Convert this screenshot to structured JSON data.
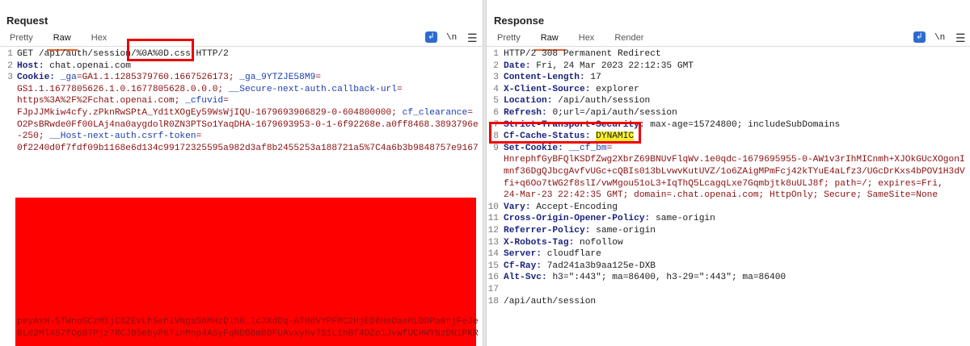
{
  "request": {
    "title": "Request",
    "tabs": [
      "Pretty",
      "Raw",
      "Hex"
    ],
    "active_tab": "Raw",
    "newline_toggle": "\\n",
    "menu_icon": "hamburger-icon",
    "lines": [
      {
        "n": "1",
        "parts": [
          {
            "t": "GET /api/auth/session/%0A%0D.css HTTP/2",
            "c": "val"
          }
        ]
      },
      {
        "n": "2",
        "parts": [
          {
            "t": "Host: ",
            "c": "key"
          },
          {
            "t": "chat.openai.com",
            "c": "val"
          }
        ]
      },
      {
        "n": "3",
        "parts": [
          {
            "t": "Cookie: ",
            "c": "key"
          },
          {
            "t": "_ga",
            "c": "blue"
          },
          {
            "t": "=GA1.1.1285379760.1667526173; ",
            "c": "maroon"
          },
          {
            "t": "_ga_9YTZJE58M9",
            "c": "blue"
          },
          {
            "t": "=",
            "c": "maroon"
          }
        ]
      },
      {
        "n": "",
        "parts": [
          {
            "t": "GS1.1.1677805626.1.0.1677805628.0.0.0; ",
            "c": "maroon"
          },
          {
            "t": "__Secure-next-auth.callback-url",
            "c": "blue"
          },
          {
            "t": "=",
            "c": "maroon"
          }
        ]
      },
      {
        "n": "",
        "parts": [
          {
            "t": "https%3A%2F%2Fchat.openai.com; ",
            "c": "maroon"
          },
          {
            "t": "_cfuvid",
            "c": "blue"
          },
          {
            "t": "=",
            "c": "maroon"
          }
        ]
      },
      {
        "n": "",
        "parts": [
          {
            "t": "FJpJJMkiw4cfy.zPknRwSPtA_Yd1tXOgEy59WsWjIQU-1679693906829-0-604800000; ",
            "c": "maroon"
          },
          {
            "t": "cf_clearance",
            "c": "blue"
          },
          {
            "t": "=",
            "c": "maroon"
          }
        ]
      },
      {
        "n": "",
        "parts": [
          {
            "t": "O2PsBRwde0Ff00LAj4na0aygdolR0ZN3PTSo1YaqDHA-1679693953-0-1-6f92268e.a0ff8468.3893796e",
            "c": "maroon"
          }
        ]
      },
      {
        "n": "",
        "parts": [
          {
            "t": "-250; ",
            "c": "maroon"
          },
          {
            "t": "__Host-next-auth.csrf-token",
            "c": "blue"
          },
          {
            "t": "=",
            "c": "maroon"
          }
        ]
      },
      {
        "n": "",
        "parts": [
          {
            "t": "0f2240d0f7fdf09b1168e6d134c99172325595a982d3af8b2455253a188721a5%7C4a6b3b9848757e9167",
            "c": "maroon"
          }
        ]
      }
    ],
    "tail_lines": [
      {
        "n": "",
        "parts": [
          {
            "t": "peyAxH-5TWnoGCzM1jC8ZEvLhSehIVNgaS6MHzDlh0_lc3XdDq-ATH8VYPFMC2HjED6HeOaeHLDDPa0rjFeJe",
            "c": "maroon"
          }
        ]
      },
      {
        "n": "",
        "parts": [
          {
            "t": "8Ld2Ml4S7fOpB7Pjz7RCJB5ebyP6TinMnp4ASyFqNDBBm0DFUAvxyhv7S1L1hBf4DZo1JvWfUCHWYNzDN1PKR",
            "c": "maroon"
          }
        ]
      }
    ]
  },
  "response": {
    "title": "Response",
    "tabs": [
      "Pretty",
      "Raw",
      "Hex",
      "Render"
    ],
    "active_tab": "Raw",
    "newline_toggle": "\\n",
    "menu_icon": "hamburger-icon",
    "lines": [
      {
        "n": "1",
        "parts": [
          {
            "t": "HTTP/2 308 Permanent Redirect",
            "c": "val"
          }
        ]
      },
      {
        "n": "2",
        "parts": [
          {
            "t": "Date: ",
            "c": "key"
          },
          {
            "t": "Fri, 24 Mar 2023 22:12:35 GMT",
            "c": "val"
          }
        ]
      },
      {
        "n": "3",
        "parts": [
          {
            "t": "Content-Length: ",
            "c": "key"
          },
          {
            "t": "17",
            "c": "val"
          }
        ]
      },
      {
        "n": "4",
        "parts": [
          {
            "t": "X-Client-Source: ",
            "c": "key"
          },
          {
            "t": "explorer",
            "c": "val"
          }
        ]
      },
      {
        "n": "5",
        "parts": [
          {
            "t": "Location: ",
            "c": "key"
          },
          {
            "t": "/api/auth/session",
            "c": "val"
          }
        ]
      },
      {
        "n": "6",
        "parts": [
          {
            "t": "Refresh: ",
            "c": "key"
          },
          {
            "t": "0;url=/api/auth/session",
            "c": "val"
          }
        ]
      },
      {
        "n": "7",
        "parts": [
          {
            "t": "Strict-Transport-Security: ",
            "c": "key"
          },
          {
            "t": "max-age=15724800; includeSubDomains",
            "c": "val"
          }
        ]
      },
      {
        "n": "8",
        "parts": [
          {
            "t": "Cf-Cache-Status: ",
            "c": "key"
          },
          {
            "t": "DYNAMIC",
            "c": "val hl"
          }
        ]
      },
      {
        "n": "9",
        "parts": [
          {
            "t": "Set-Cookie: ",
            "c": "key"
          },
          {
            "t": "__cf_bm",
            "c": "blue"
          },
          {
            "t": "=",
            "c": "maroon"
          }
        ]
      },
      {
        "n": "",
        "parts": [
          {
            "t": "HnrephfGyBFQlKSDfZwg2XbrZ69BNUvFlqWv.1e0qdc-1679695955-0-AW1v3rIhMICnmh+XJOkGUcXOgonI",
            "c": "maroon"
          }
        ]
      },
      {
        "n": "",
        "parts": [
          {
            "t": "mnf36DgQJbcgAvfvUGc+cQBIs013bLvwvKutUVZ/1o6ZAigMPmFcj42kTYuE4aLfz3/UGcDrKxs4bPOV1H3dV",
            "c": "maroon"
          }
        ]
      },
      {
        "n": "",
        "parts": [
          {
            "t": "fi+q6Oo7tWG2f8slI/vwMgou51oL3+IqThQ5LcagqLxe7Gqmbjtk8uULJ8f; path=/; expires=Fri,",
            "c": "maroon"
          }
        ]
      },
      {
        "n": "",
        "parts": [
          {
            "t": "24-Mar-23 22:42:35 GMT; domain=.chat.openai.com; HttpOnly; Secure; SameSite=None",
            "c": "maroon"
          }
        ]
      },
      {
        "n": "10",
        "parts": [
          {
            "t": "Vary: ",
            "c": "key"
          },
          {
            "t": "Accept-Encoding",
            "c": "val"
          }
        ]
      },
      {
        "n": "11",
        "parts": [
          {
            "t": "Cross-Origin-Opener-Policy: ",
            "c": "key"
          },
          {
            "t": "same-origin",
            "c": "val"
          }
        ]
      },
      {
        "n": "12",
        "parts": [
          {
            "t": "Referrer-Policy: ",
            "c": "key"
          },
          {
            "t": "same-origin",
            "c": "val"
          }
        ]
      },
      {
        "n": "13",
        "parts": [
          {
            "t": "X-Robots-Tag: ",
            "c": "key"
          },
          {
            "t": "nofollow",
            "c": "val"
          }
        ]
      },
      {
        "n": "14",
        "parts": [
          {
            "t": "Server: ",
            "c": "key"
          },
          {
            "t": "cloudflare",
            "c": "val"
          }
        ]
      },
      {
        "n": "15",
        "parts": [
          {
            "t": "Cf-Ray: ",
            "c": "key"
          },
          {
            "t": "7ad241a3b9aa125e-DXB",
            "c": "val"
          }
        ]
      },
      {
        "n": "16",
        "parts": [
          {
            "t": "Alt-Svc: ",
            "c": "key"
          },
          {
            "t": "h3=\":443\"; ma=86400, h3-29=\":443\"; ma=86400",
            "c": "val"
          }
        ]
      },
      {
        "n": "17",
        "parts": []
      },
      {
        "n": "18",
        "parts": [
          {
            "t": "/api/auth/session",
            "c": "val"
          }
        ]
      }
    ]
  },
  "colors": {
    "accent": "#e8622b",
    "toggle_blue": "#2e6bd1",
    "redaction": "#ff0000",
    "annotation": "#ee0000",
    "highlight": "#f4f02d"
  }
}
